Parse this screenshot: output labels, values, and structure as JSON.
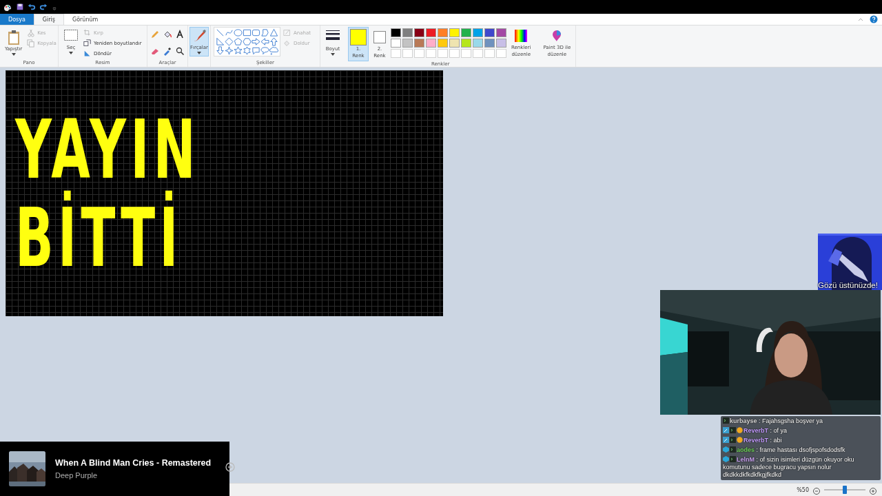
{
  "tabs": [
    {
      "label": "Dosya",
      "kind": "file",
      "selected": false
    },
    {
      "label": "Giriş",
      "kind": "tab",
      "selected": true
    },
    {
      "label": "Görünüm",
      "kind": "tab",
      "selected": false
    }
  ],
  "ribbon": {
    "clipboard": {
      "paste": "Yapıştır",
      "cut": {
        "label": "Kes",
        "disabled": true
      },
      "copy": {
        "label": "Kopyala",
        "disabled": true
      },
      "group": "Pano"
    },
    "image": {
      "select": "Seç",
      "crop": {
        "label": "Kırp",
        "disabled": true
      },
      "resize": {
        "label": "Yeniden boyutlandır",
        "disabled": false
      },
      "rotate": {
        "label": "Döndür",
        "disabled": false
      },
      "group": "Resim"
    },
    "tools": {
      "group": "Araçlar"
    },
    "brushes": {
      "label": "Fırçalar",
      "selected": true
    },
    "shapes": {
      "outline": {
        "label": "Anahat",
        "disabled": true
      },
      "fill": {
        "label": "Doldur",
        "disabled": true
      },
      "group": "Şekiller"
    },
    "size": {
      "label": "Boyut"
    },
    "color1": {
      "label_1": "1.",
      "label_2": "Renk",
      "color": "#ffff00",
      "selected": true
    },
    "color2": {
      "label_1": "2.",
      "label_2": "Renk",
      "color": "#ffffff",
      "selected": false
    },
    "palette": [
      {
        "color": "#000000"
      },
      {
        "color": "#7f7f7f"
      },
      {
        "color": "#880015"
      },
      {
        "color": "#ed1c24"
      },
      {
        "color": "#ff7f27"
      },
      {
        "color": "#fff200"
      },
      {
        "color": "#22b14c"
      },
      {
        "color": "#00a2e8"
      },
      {
        "color": "#3f48cc"
      },
      {
        "color": "#a349a4"
      },
      {
        "color": "#ffffff"
      },
      {
        "color": "#c3c3c3"
      },
      {
        "color": "#b97a57"
      },
      {
        "color": "#ffaec9"
      },
      {
        "color": "#ffc90e"
      },
      {
        "color": "#efe4b0"
      },
      {
        "color": "#b5e61d"
      },
      {
        "color": "#99d9ea"
      },
      {
        "color": "#7092be"
      },
      {
        "color": "#c8bfe7"
      }
    ],
    "edit_colors": {
      "label_1": "Renkleri",
      "label_2": "düzenle"
    },
    "paint3d": {
      "label_1": "Paint 3D ile",
      "label_2": "düzenle"
    },
    "colors_group": "Renkler"
  },
  "canvas": {
    "lines": [
      "YAYIN",
      "BİTTİ"
    ]
  },
  "overlay_image": {
    "caption": "Gözü üstünüzde!"
  },
  "now_playing": {
    "title": "When A Blind Man Cries - Remastered",
    "artist": "Deep Purple"
  },
  "chat": [
    {
      "user": "kurbayse",
      "color": "#d8d8d8",
      "badges": [
        {
          "kind": "terminal"
        }
      ],
      "text": ": Fajahsgsha boşver ya"
    },
    {
      "user": "ReverbT",
      "color": "#c39cff",
      "badges": [
        {
          "kind": "wrench"
        },
        {
          "kind": "terminal"
        },
        {
          "kind": "coin"
        }
      ],
      "text": ": of ya"
    },
    {
      "user": "ReverbT",
      "color": "#c39cff",
      "badges": [
        {
          "kind": "wrench"
        },
        {
          "kind": "terminal"
        },
        {
          "kind": "coin"
        }
      ],
      "text": ": abi"
    },
    {
      "user": "aodes",
      "color": "#6fd05c",
      "badges": [
        {
          "kind": "cube"
        },
        {
          "kind": "terminal"
        }
      ],
      "text": ": frame hastası dsofjspofsdodsfk"
    },
    {
      "user": "LelnM",
      "color": "#c8a0f0",
      "badges": [
        {
          "kind": "cube"
        },
        {
          "kind": "terminal"
        }
      ],
      "text": ": of sizin isimleri düzgün okuyor oku komutunu sadece bugracu yapsın nolur dkdkkdkfkdkfkgjfkdkd"
    }
  ],
  "status_bar": {
    "zoom": "%50",
    "level": 0.5
  }
}
